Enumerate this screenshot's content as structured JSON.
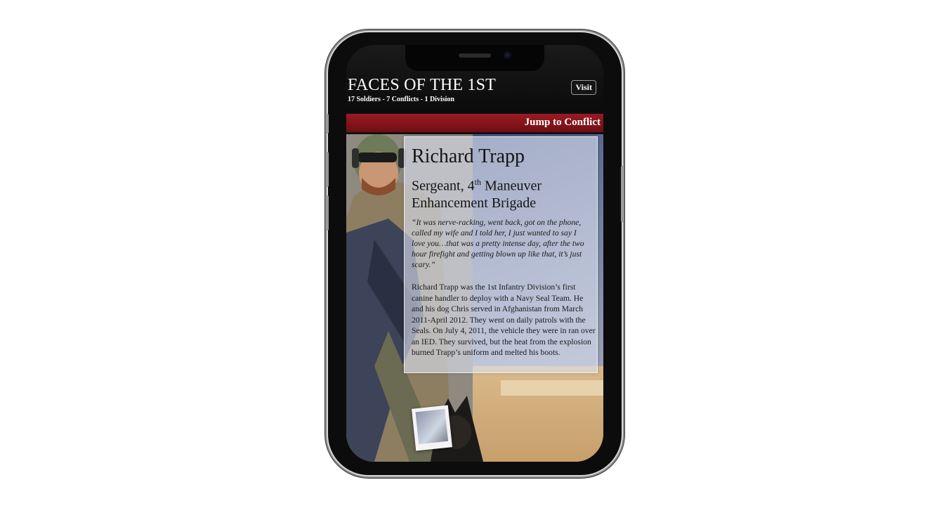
{
  "header": {
    "title": "FACES OF THE 1ST",
    "subtitle": "17 Soldiers - 7 Conflicts - 1 Division",
    "visit_label": "Visit"
  },
  "nav": {
    "jump_label": "Jump to Conflict"
  },
  "profile": {
    "name": "Richard Trapp",
    "rank_prefix": "Sergeant, 4",
    "rank_sup": "th",
    "rank_suffix": " Maneuver Enhancement Brigade",
    "quote": "“It was nerve-racking, went back, got on the phone, called my wife and I told her, I just wanted to say I love you…that was a pretty intense day, after the two hour firefight and getting blown up like that, it’s just scary.”",
    "bio": "Richard Trapp was the 1st Infantry Division’s first canine handler to deploy with a Navy Seal Team. He and his dog Chris served in Afghanistan from March 2011-April 2012. They went on daily patrols with the Seals. On July 4, 2011, the vehicle they were in ran over an IED. They survived, but the heat from the explosion burned Trapp’s uniform and melted his boots."
  },
  "colors": {
    "accent_red": "#8b1a1f",
    "header_bg": "#111111"
  }
}
